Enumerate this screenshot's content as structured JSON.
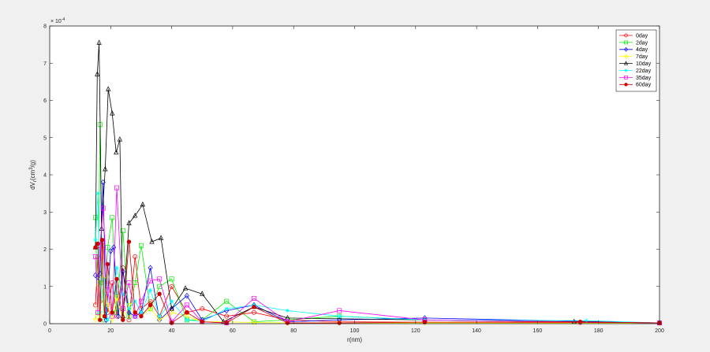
{
  "chart_data": {
    "type": "line",
    "xlabel": "r(nm)",
    "ylabel_main": "dV",
    "ylabel_sub": "r",
    "ylabel_unit_pre": "(cm",
    "ylabel_unit_sup": "3",
    "ylabel_unit_post": "/g)",
    "y_exponent_base": "× 10",
    "y_exponent_power": "-4",
    "xlim": [
      0,
      200
    ],
    "ylim": [
      0,
      8
    ],
    "xticks": [
      "0",
      "20",
      "40",
      "60",
      "80",
      "100",
      "120",
      "140",
      "160",
      "180",
      "200"
    ],
    "yticks": [
      "0",
      "1",
      "2",
      "3",
      "4",
      "5",
      "6",
      "7",
      "8"
    ],
    "grid": false,
    "legend_position": "top-right",
    "series": [
      {
        "name": "0day",
        "color": "#ff0000",
        "marker": "circle",
        "x": [
          15,
          15.8,
          16.5,
          17.5,
          19,
          20.5,
          22,
          24,
          26,
          28,
          30,
          33,
          36,
          40,
          45,
          50,
          58,
          67,
          78,
          95,
          123,
          174,
          200
        ],
        "y": [
          0.5,
          1.8,
          0.6,
          2.2,
          0.3,
          1.1,
          0.2,
          1.5,
          0.1,
          1.8,
          0.4,
          0.6,
          0.2,
          1.0,
          0.3,
          0.4,
          0.2,
          0.3,
          0.1,
          0.05,
          0.04,
          0.03,
          0.02
        ]
      },
      {
        "name": "2day",
        "color": "#00ee00",
        "marker": "square",
        "x": [
          15,
          15.8,
          16.5,
          17.2,
          18,
          19,
          20.5,
          22,
          24,
          26,
          28,
          30,
          33,
          36,
          40,
          45,
          50,
          58,
          67,
          78,
          95,
          123,
          200
        ],
        "y": [
          2.85,
          0.2,
          5.35,
          1.1,
          0.1,
          2.05,
          2.85,
          0.3,
          2.5,
          0.2,
          1.1,
          2.1,
          0.4,
          1.0,
          1.2,
          0.1,
          0.1,
          0.6,
          0.05,
          0.1,
          0.2,
          0.1,
          0.02
        ]
      },
      {
        "name": "4day",
        "color": "#0000ff",
        "marker": "diamond",
        "x": [
          15,
          15.8,
          16.5,
          17.5,
          18.5,
          20,
          21,
          22.5,
          24,
          26,
          28,
          30,
          33,
          36,
          40,
          45,
          50,
          58,
          67,
          78,
          95,
          123,
          200
        ],
        "y": [
          1.3,
          1.25,
          1.35,
          3.8,
          0.1,
          1.95,
          2.05,
          0.2,
          1.4,
          0.3,
          0.2,
          0.3,
          1.5,
          0.1,
          0.4,
          0.75,
          0.1,
          0.35,
          0.5,
          0.05,
          0.1,
          0.15,
          0.02
        ]
      },
      {
        "name": "7day",
        "color": "#ffff00",
        "marker": "triangle-down",
        "x": [
          15,
          15.8,
          16.5,
          17.5,
          19,
          20.5,
          22,
          24,
          26,
          28,
          30,
          33,
          36,
          40,
          45,
          50,
          58,
          67,
          78,
          95,
          123,
          200
        ],
        "y": [
          0.1,
          1.0,
          0.2,
          1.2,
          0.5,
          0.1,
          0.7,
          0.1,
          0.5,
          0.3,
          0.2,
          0.4,
          0.1,
          0.3,
          0.2,
          0.05,
          0.05,
          0.03,
          0.02,
          0.02,
          0.02,
          0.01
        ]
      },
      {
        "name": "10day",
        "color": "#000000",
        "marker": "triangle-up",
        "x": [
          15,
          15.6,
          16.2,
          17,
          18.2,
          19.2,
          20.5,
          21.8,
          23,
          24,
          26,
          28,
          30.5,
          33.5,
          36.5,
          40,
          44.5,
          50,
          57,
          67,
          78,
          123,
          172,
          200
        ],
        "y": [
          2.05,
          6.7,
          7.55,
          2.55,
          4.15,
          6.3,
          5.65,
          4.6,
          4.95,
          0.2,
          2.7,
          2.9,
          3.2,
          2.2,
          2.3,
          0.4,
          0.95,
          0.8,
          0.05,
          0.45,
          0.15,
          0.1,
          0.05,
          0.02
        ]
      },
      {
        "name": "22day",
        "color": "#00ffff",
        "marker": "star",
        "x": [
          15,
          15.8,
          16.5,
          17.5,
          19,
          20.5,
          22,
          24,
          26,
          28,
          30,
          33,
          36,
          40,
          45,
          50,
          58,
          67,
          78,
          95,
          123,
          176,
          200
        ],
        "y": [
          2.25,
          3.5,
          0.3,
          1.2,
          0.1,
          0.3,
          1.5,
          0.8,
          0.4,
          0.6,
          0.3,
          0.9,
          0.2,
          0.6,
          0.1,
          0.05,
          0.4,
          0.5,
          0.35,
          0.2,
          0.1,
          0.08,
          0.02
        ]
      },
      {
        "name": "35day",
        "color": "#ff00ff",
        "marker": "square",
        "x": [
          15,
          15.8,
          16.5,
          17.5,
          19,
          20.5,
          22,
          24,
          26,
          28,
          30,
          33,
          36,
          40,
          45,
          50,
          58,
          67,
          78,
          95,
          123,
          200
        ],
        "y": [
          1.8,
          0.3,
          2.1,
          3.1,
          0.9,
          0.2,
          3.65,
          0.4,
          1.1,
          0.2,
          0.6,
          1.15,
          1.2,
          0.05,
          0.5,
          0.05,
          0.02,
          0.68,
          0.05,
          0.35,
          0.1,
          0.02
        ]
      },
      {
        "name": "60day",
        "color": "#cc0000",
        "marker": "asterisk",
        "x": [
          15,
          15.8,
          16.5,
          17.2,
          18,
          19,
          20.5,
          22,
          24,
          26,
          28,
          30,
          33,
          36,
          40,
          45,
          50,
          58,
          67,
          78,
          95,
          123,
          174,
          200
        ],
        "y": [
          2.05,
          2.15,
          0.1,
          2.25,
          0.2,
          1.6,
          0.3,
          1.2,
          0.1,
          2.2,
          0.3,
          0.2,
          0.5,
          0.8,
          0.02,
          0.3,
          0.05,
          0.02,
          0.45,
          0.02,
          0.02,
          0.04,
          0.05,
          0.02
        ]
      }
    ]
  }
}
